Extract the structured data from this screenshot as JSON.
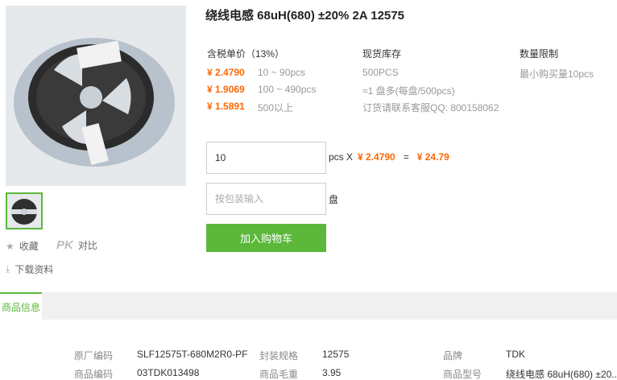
{
  "product": {
    "title": "绕线电感 68uH(680) ±20% 2A 12575",
    "image_alt": "reel-of-inductors"
  },
  "side_actions": {
    "favorite": "收藏",
    "pk_logo": "PK",
    "compare": "对比",
    "download": "下载资料"
  },
  "pricing": {
    "header": "含税单价（13%）",
    "tiers": [
      {
        "price": "¥ 2.4790",
        "range": "10 ~ 90pcs"
      },
      {
        "price": "¥ 1.9069",
        "range": "100 ~ 490pcs"
      },
      {
        "price": "¥ 1.5891",
        "range": "500以上"
      }
    ]
  },
  "stock": {
    "header": "现货库存",
    "quantity": "500PCS",
    "reel_info": "≈1 盘多(每盘/500pcs)",
    "contact": "订货请联系客服QQ: 800158062"
  },
  "limit": {
    "header": "数量限制",
    "min": "最小购买量10pcs"
  },
  "order": {
    "qty_value": "10",
    "unit": "pcs X",
    "unit_price": "¥ 2.4790",
    "equals": "=",
    "total": "¥ 24.79",
    "pack_placeholder": "按包装输入",
    "pack_unit": "盘",
    "add_to_cart": "加入购物车"
  },
  "tabs": {
    "product_info": "商品信息"
  },
  "info": {
    "rows": [
      [
        {
          "label": "原厂编码",
          "value": "SLF12575T-680M2R0-PF"
        },
        {
          "label": "封装规格",
          "value": "12575"
        },
        {
          "label": "品牌",
          "value": "TDK"
        }
      ],
      [
        {
          "label": "商品编码",
          "value": "03TDK013498"
        },
        {
          "label": "商品毛重",
          "value": "3.95"
        },
        {
          "label": "商品型号",
          "value": "绕线电感 68uH(680) ±20..."
        }
      ]
    ]
  },
  "colors": {
    "accent_green": "#5bb83a",
    "price_orange": "#ff6600"
  }
}
